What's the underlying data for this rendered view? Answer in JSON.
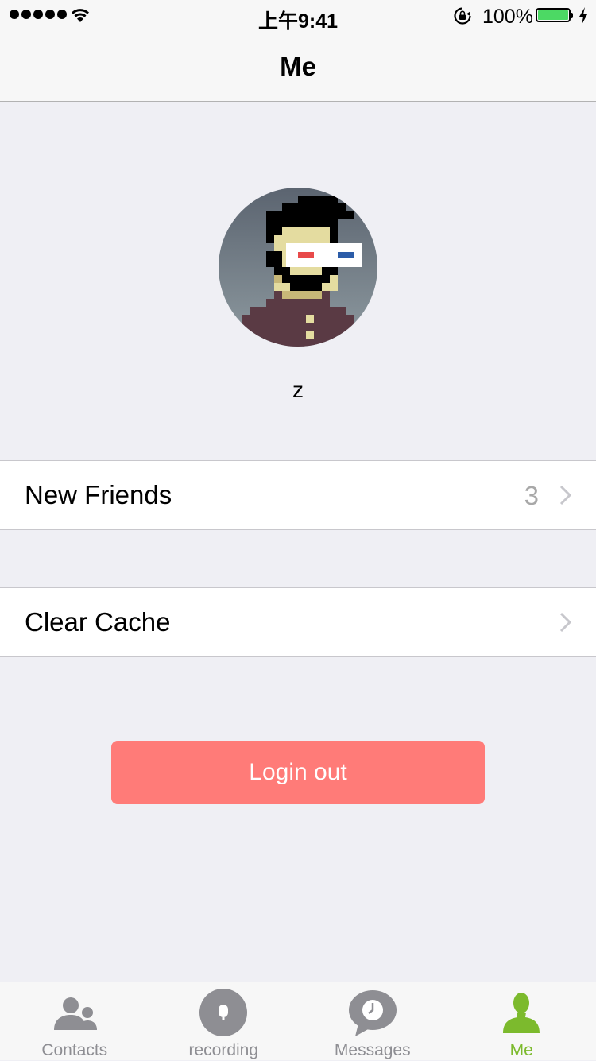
{
  "status_bar": {
    "time": "上午9:41",
    "battery_percent": "100%",
    "battery_level": 1.0,
    "icons": [
      "signal-dots-icon",
      "wifi-icon",
      "rotation-lock-icon",
      "battery-icon",
      "charging-bolt-icon"
    ]
  },
  "nav": {
    "title": "Me"
  },
  "profile": {
    "username": "z",
    "avatar_icon": "pixel-art-avatar"
  },
  "cells": {
    "new_friends": {
      "label": "New Friends",
      "count": "3"
    },
    "clear_cache": {
      "label": "Clear Cache"
    }
  },
  "logout_button": {
    "label": "Login out",
    "color": "#ff7b78"
  },
  "tabbar": {
    "active_color": "#7cba2d",
    "inactive_color": "#8e8e93",
    "tabs": [
      {
        "label": "Contacts",
        "icon": "contacts-icon",
        "active": false
      },
      {
        "label": "recording",
        "icon": "microphone-icon",
        "active": false
      },
      {
        "label": "Messages",
        "icon": "chat-clock-icon",
        "active": false
      },
      {
        "label": "Me",
        "icon": "person-icon",
        "active": true
      }
    ]
  }
}
